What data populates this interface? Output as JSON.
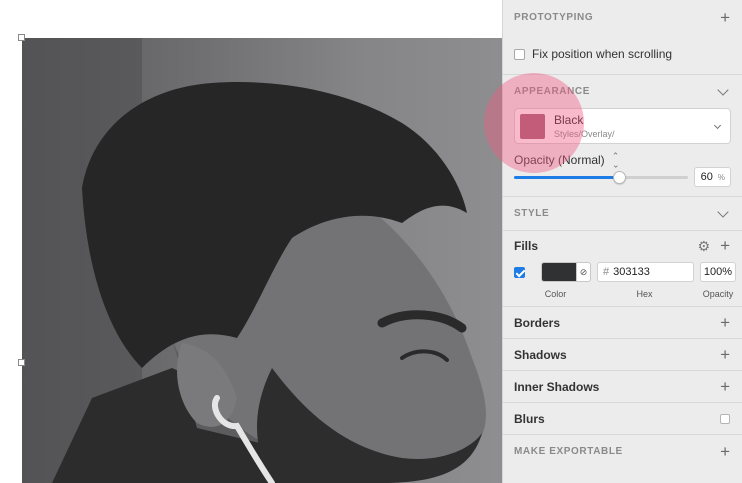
{
  "prototyping": {
    "title": "PROTOTYPING",
    "add_icon": "+",
    "fix_position_label": "Fix position when scrolling",
    "fix_position_checked": false
  },
  "appearance": {
    "title": "APPEARANCE",
    "style_name": "Black",
    "style_path": "Styles/Overlay/",
    "swatch_color": "#a25d70",
    "opacity_label": "Opacity (Normal)",
    "opacity_value": "60",
    "opacity_unit": "%",
    "opacity_fraction": 0.6
  },
  "style": {
    "title": "STYLE",
    "fills": {
      "label": "Fills",
      "enabled": true,
      "color": "#303133",
      "hex_prefix": "#",
      "hex": "303133",
      "opacity": "100%",
      "color_caption": "Color",
      "hex_caption": "Hex",
      "opacity_caption": "Opacity"
    },
    "borders_label": "Borders",
    "shadows_label": "Shadows",
    "inner_shadows_label": "Inner Shadows",
    "blurs_label": "Blurs"
  },
  "make_exportable": {
    "title": "MAKE EXPORTABLE"
  },
  "colors": {
    "accent": "#1d7ce6",
    "touch_highlight": "#f05a82"
  }
}
